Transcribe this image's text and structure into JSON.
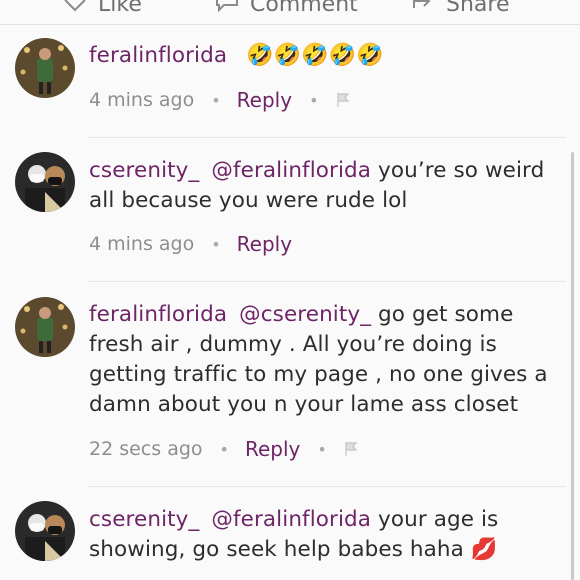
{
  "actions": {
    "like_label": "Like",
    "comment_label": "Comment",
    "share_label": "Share"
  },
  "comments": [
    {
      "username": "feralinflorida",
      "mention": "",
      "text": "🤣🤣🤣🤣🤣",
      "time": "4 mins ago",
      "reply_label": "Reply",
      "has_flag": true
    },
    {
      "username": "cserenity_",
      "mention": "@feralinflorida",
      "text": "you’re so weird all because you were rude lol",
      "time": "4 mins ago",
      "reply_label": "Reply",
      "has_flag": false
    },
    {
      "username": "feralinflorida",
      "mention": "@cserenity_",
      "text": "go get some fresh air , dummy . All you’re doing is getting traffic to my page , no one gives a damn about you n your lame ass closet",
      "time": "22 secs ago",
      "reply_label": "Reply",
      "has_flag": true
    },
    {
      "username": "cserenity_",
      "mention": "@feralinflorida",
      "text": "your age is showing, go seek help babes haha 💋",
      "time": "",
      "reply_label": "",
      "has_flag": false
    }
  ],
  "colors": {
    "accent": "#6d2566",
    "meta": "#8e8e92",
    "background": "#fbfafb"
  }
}
